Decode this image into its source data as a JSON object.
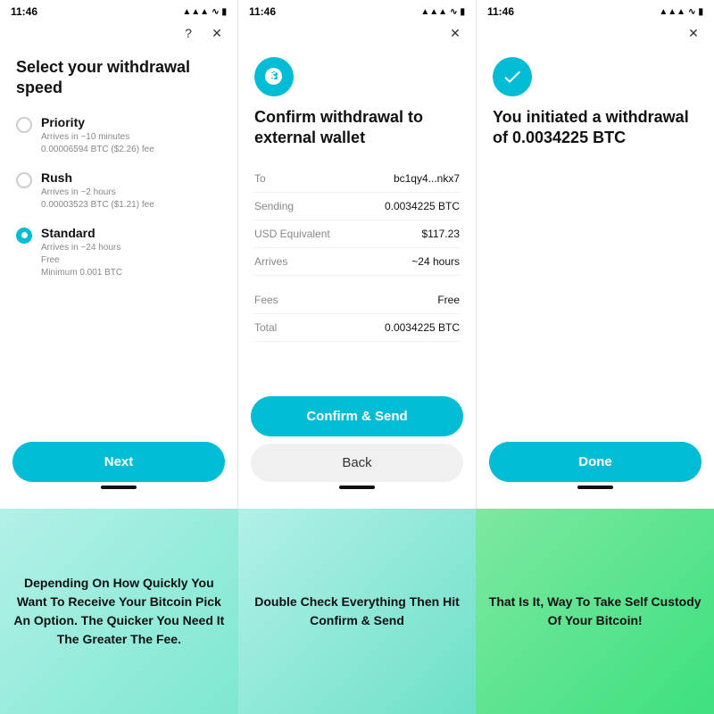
{
  "screens": [
    {
      "id": "speed",
      "status_time": "11:46",
      "title": "Select your withdrawal speed",
      "options": [
        {
          "label": "Priority",
          "desc_line1": "Arrives in ~10 minutes",
          "desc_line2": "0.00006594 BTC ($2.26) fee",
          "selected": false
        },
        {
          "label": "Rush",
          "desc_line1": "Arrives in ~2 hours",
          "desc_line2": "0.00003523 BTC ($1.21) fee",
          "selected": false
        },
        {
          "label": "Standard",
          "desc_line1": "Arrives in ~24 hours",
          "desc_line2": "Free",
          "desc_line3": "Minimum 0.001 BTC",
          "selected": true
        }
      ],
      "next_label": "Next",
      "has_help": true,
      "has_close": true
    },
    {
      "id": "confirm",
      "status_time": "11:46",
      "title": "Confirm withdrawal to external wallet",
      "details": [
        {
          "label": "To",
          "value": "bc1qy4...nkx7"
        },
        {
          "label": "Sending",
          "value": "0.0034225 BTC"
        },
        {
          "label": "USD Equivalent",
          "value": "$117.23"
        },
        {
          "label": "Arrives",
          "value": "~24 hours"
        }
      ],
      "details2": [
        {
          "label": "Fees",
          "value": "Free"
        },
        {
          "label": "Total",
          "value": "0.0034225 BTC"
        }
      ],
      "confirm_label": "Confirm & Send",
      "back_label": "Back",
      "has_close": true
    },
    {
      "id": "success",
      "status_time": "11:46",
      "title": "You initiated a withdrawal of 0.0034225 BTC",
      "done_label": "Done",
      "has_close": true
    }
  ],
  "captions": [
    {
      "text": "Depending On How Quickly You Want To Receive Your Bitcoin Pick An Option. The Quicker You Need It The Greater The Fee."
    },
    {
      "text": "Double Check Everything Then Hit Confirm & Send"
    },
    {
      "text": "That Is It, Way To Take Self Custody Of Your Bitcoin!"
    }
  ]
}
